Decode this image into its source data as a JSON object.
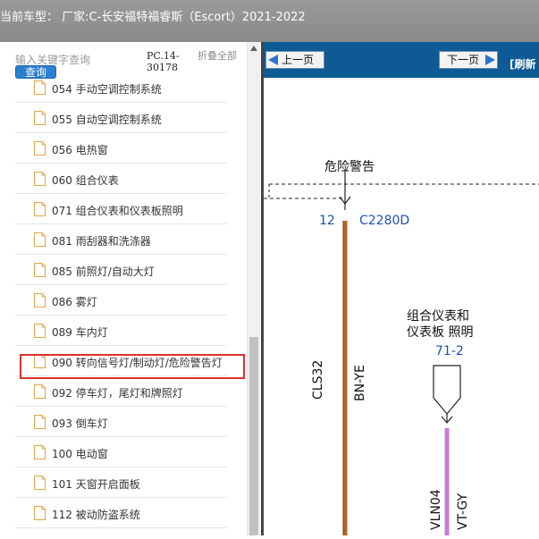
{
  "window": {
    "title": "当前车型：  厂家:C-长安福特福睿斯（Escort）2021-2022"
  },
  "search": {
    "placeholder": "输入关键字查询",
    "button_label": "查询"
  },
  "doc_code": "PC.14-30178",
  "collapse_all_label": "折叠全部",
  "tree": {
    "items": [
      {
        "label": "054 手动空调控制系统"
      },
      {
        "label": "055 自动空调控制系统"
      },
      {
        "label": "056 电热窗"
      },
      {
        "label": "060 组合仪表"
      },
      {
        "label": "071 组合仪表和仪表板照明"
      },
      {
        "label": "081 雨刮器和洗涤器"
      },
      {
        "label": "085 前照灯/自动大灯"
      },
      {
        "label": "086 雾灯"
      },
      {
        "label": "089 车内灯"
      },
      {
        "label": "090 转向信号灯/制动灯/危险警告灯"
      },
      {
        "label": "092 停车灯，尾灯和牌照灯"
      },
      {
        "label": "093 倒车灯"
      },
      {
        "label": "100 电动窗"
      },
      {
        "label": "101 天窗开启面板"
      },
      {
        "label": "112 被动防盗系统"
      }
    ],
    "selected_index": 9
  },
  "toolbar": {
    "prev_label": "上一页",
    "next_label": "下一页",
    "refresh_label": "[刷新"
  },
  "diagram": {
    "hazard_label": "危险警告",
    "pin_number": "12",
    "connector_id": "C2280D",
    "circuit_1": "CLS32",
    "wire_color_1": "BN-YE",
    "component_label_line1": "组合仪表和",
    "component_label_line2": "仪表板 照明",
    "component_pin": "71-2",
    "circuit_2": "VLN04",
    "wire_color_2": "VT-GY"
  },
  "colors": {
    "titlebar": "#8f8f8f",
    "toolbar": "#0d5a94",
    "accent_button": "#2a7fd0",
    "highlight_border": "#d9322b",
    "wire_brown": "#b5661f",
    "wire_violet": "#c47fd0",
    "diagram_blue": "#1d4fb0"
  }
}
